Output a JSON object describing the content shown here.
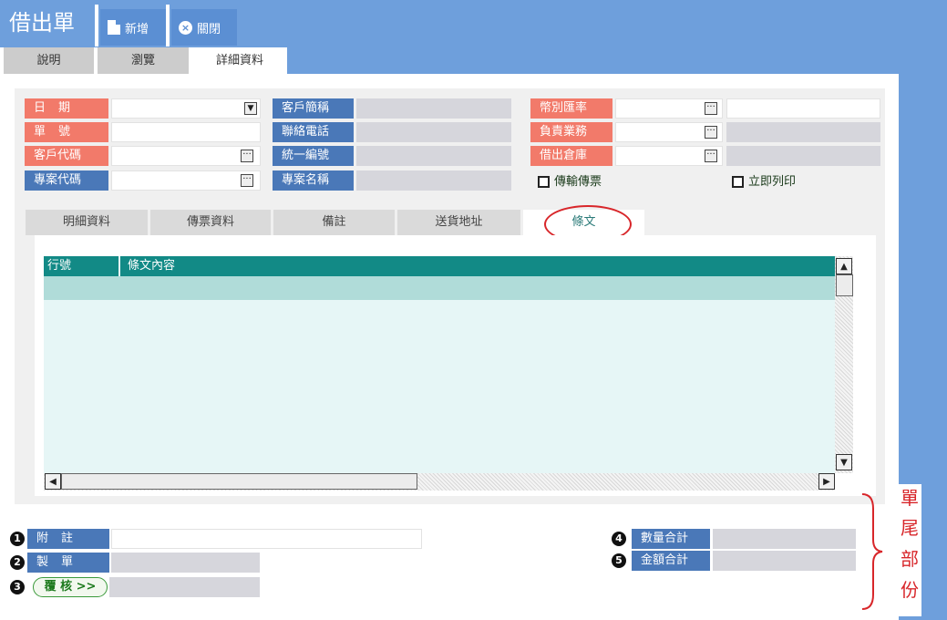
{
  "header": {
    "title": "借出單",
    "new_label": "新增",
    "close_label": "關閉"
  },
  "main_tabs": [
    "說明",
    "瀏覽",
    "詳細資料"
  ],
  "form": {
    "date_label": "日期",
    "docno_label": "單號",
    "custcode_label": "客戶代碼",
    "projcode_label": "專案代碼",
    "custshort_label": "客戶簡稱",
    "phone_label": "聯絡電話",
    "taxid_label": "統一編號",
    "projname_label": "專案名稱",
    "currency_label": "幣別匯率",
    "salesrep_label": "負責業務",
    "warehouse_label": "借出倉庫",
    "chk_transfer_label": "傳輸傳票",
    "chk_print_label": "立即列印"
  },
  "sub_tabs": [
    "明細資料",
    "傳票資料",
    "備註",
    "送貨地址",
    "條文"
  ],
  "grid": {
    "headers": [
      "行號",
      "條文內容"
    ]
  },
  "footer": {
    "note_label": "附註",
    "maker_label": "製單",
    "review_label": "覆 核 >>",
    "qty_total_label": "數量合計",
    "amt_total_label": "金額合計",
    "num1": "1",
    "num2": "2",
    "num3": "3",
    "num4": "4",
    "num5": "5"
  },
  "annotation": [
    "單",
    "尾",
    "部",
    "份"
  ],
  "colors": {
    "title_bar": "#6e9fdc",
    "label_red": "#f27a6a",
    "label_blue": "#4a78b8",
    "grid_header": "#128a86",
    "annotation": "#d8262a"
  }
}
